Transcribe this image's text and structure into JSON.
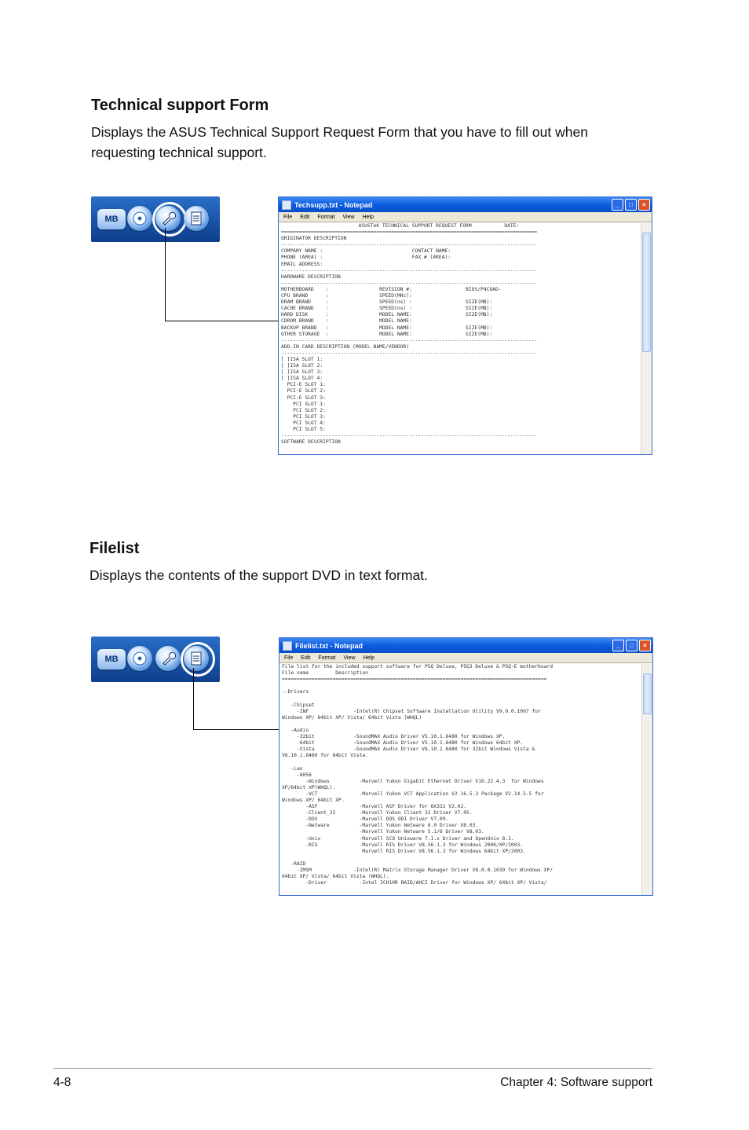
{
  "section1": {
    "title": "Technical support Form",
    "description_line1": "Displays the ASUS Technical Support Request Form that you have to fill out when",
    "description_line2": "requesting technical support.",
    "toolbar": {
      "mb_label": "MB"
    },
    "window": {
      "title": "Techsupp.txt - Notepad",
      "menu": [
        "File",
        "Edit",
        "Format",
        "View",
        "Help"
      ],
      "lines": [
        "                          ASUSTeK TECHNICAL SUPPORT REQUEST FORM           DATE:",
        "======================================================================================",
        "ORIGINATOR DESCRIPTION",
        "--------------------------------------------------------------------------------------",
        "COMPANY NAME :                              CONTACT NAME:",
        "PHONE (AREA) :                              FAX # (AREA):",
        "EMAIL ADDRESS:",
        "--------------------------------------------------------------------------------------",
        "HARDWARE DESCRIPTION",
        "--------------------------------------------------------------------------------------",
        "MOTHERBOARD    :                 REVISION #:                  BIOS/P4C8AD-",
        "CPU BRAND      :                 SPEED(MHz):",
        "DRAM BRAND     :                 SPEED(ns) :                  SIZE(MB):",
        "CACHE BRAND    :                 SPEED(ns) :                  SIZE(MB):",
        "HARD DISK      :                 MODEL NAME:                  SIZE(MB):",
        "CDROM BRAND    :                 MODEL NAME:",
        "BACKUP BRAND   :                 MODEL NAME:                  SIZE(MB):",
        "OTHER STORAGE  :                 MODEL NAME:                  SIZE(MB):",
        "--------------------------------------------------------------------------------------",
        "ADD-IN CARD DESCRIPTION (MODEL NAME/VENDOR)",
        "--------------------------------------------------------------------------------------",
        "[ ]ISA SLOT 1:",
        "[ ]ISA SLOT 2:",
        "[ ]ISA SLOT 3:",
        "[ ]ISA SLOT 4:",
        "  PCI-E SLOT 1:",
        "  PCI-E SLOT 2:",
        "  PCI-E SLOT 3:",
        "    PCI SLOT 1:",
        "    PCI SLOT 2:",
        "    PCI SLOT 3:",
        "    PCI SLOT 4:",
        "    PCI SLOT 5:",
        "--------------------------------------------------------------------------------------",
        "SOFTWARE DESCRIPTION"
      ]
    }
  },
  "section2": {
    "title": "Filelist",
    "description": "Displays the contents of the support DVD in text format.",
    "toolbar": {
      "mb_label": "MB"
    },
    "window": {
      "title": "Filelist.txt - Notepad",
      "menu": [
        "File",
        "Edit",
        "Format",
        "View",
        "Help"
      ],
      "lines": [
        "File list for the included support software for P5Q Deluxe, P5Q3 Deluxe & P5Q-E motherboard",
        "File name         Description",
        "=========================================================================================",
        "",
        "--Drivers",
        "",
        "   -Chipset",
        "     -INF               -Intel(R) Chipset Software Installation Utility V9.0.0.1007 for",
        "Windows XP/ 64bit XP/ Vista/ 64bit Vista (WHQL)",
        "",
        "   -Audio",
        "     -32bit             -SoundMAX Audio Driver V5.10.1.6480 for Windows XP.",
        "     -64bit             -SoundMAX Audio Driver V5.10.1.6480 for Windows 64bit XP.",
        "     -Vista             -SoundMAX Audio Driver V6.10.1.6480 for 32bit Windows Vista &",
        "V6.10.1.6480 for 64bit Vista.",
        "",
        "   -Lan",
        "     -8056",
        "        -Windows          -Marvell Yukon Gigabit Ethernet Driver V10.22.4.3  for Windows",
        "XP/64bit XP(WHQL).",
        "        -VCT              -Marvell Yukon VCT Application V2.16.5.3 Package V2.14.5.5 for",
        "Windows XP/ 64bit XP.",
        "        -ASF              -Marvell ASF Driver for 8X332 V2.02.",
        "        -Client_32        -Marvell Yukon Client 32 Driver V7.05.",
        "        -DOS              -Marvell DOS ODI Driver V7.09.",
        "        -Netware          -Marvell Yukon Netware 6.0 Driver V8.03.",
        "                          -Marvell Yukon Netware 5.1/6 Driver V8.03.",
        "        -Unix             -Marvell SCO Unixware 7.1.x Driver and OpenUnix 8.1.",
        "        -RIS              -Marvell RIS Driver V8.56.1.3 for Windows 2000/XP/2003.",
        "                           Marvell RIS Driver V8.56.1.3 for Windows 64bit XP/2003.",
        "",
        "   -RAID",
        "     -IMSM              -Intel(R) Matrix Storage Manager Driver V8.0.0.1039 for Windows XP/",
        "64bit XP/ Vista/ 64bit Vista (WHQL).",
        "        -Driver           -Intel ICH10R RAID/AHCI Driver for Windows XP/ 64bit XP/ Vista/"
      ]
    }
  },
  "footer": {
    "page_number": "4-8",
    "chapter": "Chapter 4: Software support"
  }
}
